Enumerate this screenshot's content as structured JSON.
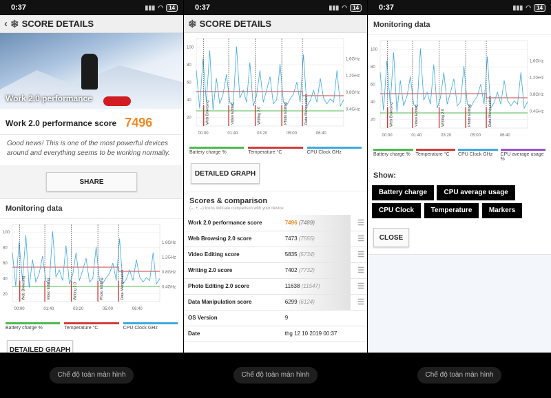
{
  "status": {
    "time": "0:37",
    "battery": "14"
  },
  "app": {
    "title": "SCORE DETAILS"
  },
  "hero": {
    "caption": "Work 2.0 performance"
  },
  "score": {
    "label": "Work 2.0 performance score",
    "value": "7496"
  },
  "description": "Good news! This is one of the most powerful devices around and everything seems to be working normally.",
  "buttons": {
    "share": "SHARE",
    "detailed_graph": "DETAILED GRAPH",
    "close": "CLOSE"
  },
  "monitoring": {
    "title": "Monitoring data"
  },
  "legend": [
    {
      "label": "Battery charge %",
      "color": "#4cb84c"
    },
    {
      "label": "Temperature °C",
      "color": "#d23a3a"
    },
    {
      "label": "CPU Clock GHz",
      "color": "#3aa9e0"
    },
    {
      "label": "CPU average usage %",
      "color": "#9b4fd1"
    }
  ],
  "chart_data": {
    "type": "line",
    "x_ticks": [
      "00:00",
      "01:40",
      "03:20",
      "05:00",
      "06:40"
    ],
    "y_left_ticks": [
      "100",
      "80",
      "60",
      "40",
      "20"
    ],
    "y_right_ticks": [
      "1.6GHz",
      "1.2GHz",
      "0.8GHz",
      "0.4GHz"
    ],
    "markers": [
      "Web Browsing",
      "Video Editing",
      "Writing 2.0",
      "Photo Editing",
      "Data Manipulation"
    ]
  },
  "comparison": {
    "title": "Scores & comparison",
    "note": "(–, +, –) Icons indicate comparison with your device",
    "rows": [
      {
        "label": "Work 2.0 performance score",
        "value": "7496",
        "cmp": "(7489)"
      },
      {
        "label": "Web Browsing 2.0 score",
        "value": "7473",
        "cmp": "(7555)"
      },
      {
        "label": "Video Editing score",
        "value": "5835",
        "cmp": "(5734)"
      },
      {
        "label": "Writing 2.0 score",
        "value": "7402",
        "cmp": "(7732)"
      },
      {
        "label": "Photo Editing 2.0 score",
        "value": "11638",
        "cmp": "(11547)"
      },
      {
        "label": "Data Manipulation score",
        "value": "6299",
        "cmp": "(6124)"
      },
      {
        "label": "OS Version",
        "value": "9",
        "cmp": ""
      },
      {
        "label": "Date",
        "value": "thg 12 10 2019 00:37",
        "cmp": ""
      }
    ]
  },
  "show": {
    "title": "Show:",
    "options": [
      "Battery charge",
      "CPU average usage",
      "CPU Clock",
      "Temperature",
      "Markers"
    ]
  },
  "nav": {
    "fullscreen": "Chế độ toàn màn hình"
  }
}
